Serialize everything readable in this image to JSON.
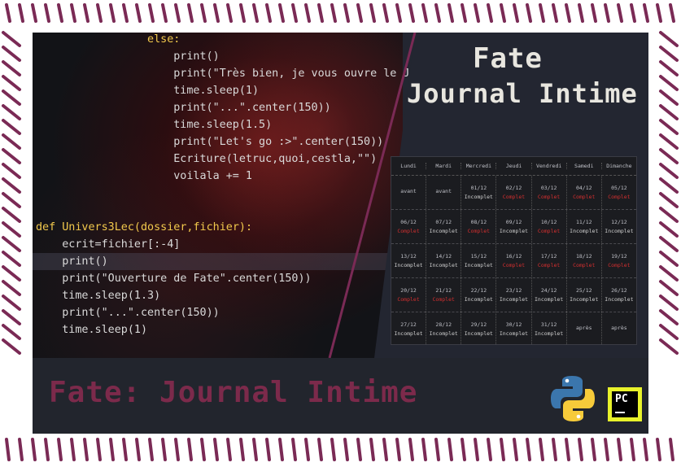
{
  "code": {
    "lines": [
      {
        "indent": 17,
        "text": "else:"
      },
      {
        "indent": 21,
        "text": "print()"
      },
      {
        "indent": 21,
        "text": "print(\"Très bien, je vous ouvre le J"
      },
      {
        "indent": 21,
        "text": "time.sleep(1)"
      },
      {
        "indent": 21,
        "text": "print(\"...\".center(150))"
      },
      {
        "indent": 21,
        "text": "time.sleep(1.5)"
      },
      {
        "indent": 21,
        "text": "print(\"Let's go :>\".center(150))"
      },
      {
        "indent": 21,
        "text": "Ecriture(letruc,quoi,cestla,\"\")"
      },
      {
        "indent": 21,
        "text": "voilala += 1"
      },
      {
        "indent": 0,
        "text": ""
      },
      {
        "indent": 0,
        "text": ""
      },
      {
        "indent": 0,
        "text": "def Univers3Lec(dossier,fichier):"
      },
      {
        "indent": 4,
        "text": "ecrit=fichier[:-4]"
      },
      {
        "indent": 4,
        "text": "print()"
      },
      {
        "indent": 4,
        "text": "print(\"Ouverture de Fate\".center(150))"
      },
      {
        "indent": 4,
        "text": "time.sleep(1.3)"
      },
      {
        "indent": 4,
        "text": "print(\"...\".center(150))"
      },
      {
        "indent": 4,
        "text": "time.sleep(1)"
      }
    ],
    "current_line": 13
  },
  "header": {
    "title_line1": "Fate",
    "title_line2": "Journal Intime"
  },
  "calendar": {
    "days": [
      "Lundi",
      "Mardi",
      "Mercredi",
      "Jeudi",
      "Vendredi",
      "Samedi",
      "Dimanche"
    ],
    "rows": [
      [
        [
          "avant",
          ""
        ],
        [
          "avant",
          ""
        ],
        [
          "01/12",
          "Incomplet"
        ],
        [
          "02/12",
          "Complet"
        ],
        [
          "03/12",
          "Complet"
        ],
        [
          "04/12",
          "Complet"
        ],
        [
          "05/12",
          "Complet"
        ]
      ],
      [
        [
          "06/12",
          "Complet"
        ],
        [
          "07/12",
          "Incomplet"
        ],
        [
          "08/12",
          "Complet"
        ],
        [
          "09/12",
          "Incomplet"
        ],
        [
          "10/12",
          "Complet"
        ],
        [
          "11/12",
          "Incomplet"
        ],
        [
          "12/12",
          "Incomplet"
        ]
      ],
      [
        [
          "13/12",
          "Incomplet"
        ],
        [
          "14/12",
          "Incomplet"
        ],
        [
          "15/12",
          "Incomplet"
        ],
        [
          "16/12",
          "Complet"
        ],
        [
          "17/12",
          "Complet"
        ],
        [
          "18/12",
          "Complet"
        ],
        [
          "19/12",
          "Complet"
        ]
      ],
      [
        [
          "20/12",
          "Complet"
        ],
        [
          "21/12",
          "Complet"
        ],
        [
          "22/12",
          "Incomplet"
        ],
        [
          "23/12",
          "Incomplet"
        ],
        [
          "24/12",
          "Incomplet"
        ],
        [
          "25/12",
          "Incomplet"
        ],
        [
          "26/12",
          "Incomplet"
        ]
      ],
      [
        [
          "27/12",
          "Incomplet"
        ],
        [
          "28/12",
          "Incomplet"
        ],
        [
          "29/12",
          "Incomplet"
        ],
        [
          "30/12",
          "Incomplet"
        ],
        [
          "31/12",
          "Incomplet"
        ],
        [
          "après",
          ""
        ],
        [
          "après",
          ""
        ]
      ]
    ],
    "status_colors": {
      "Complet": "#d32f2f",
      "Incomplet": "#cfcfcf"
    }
  },
  "bottom": {
    "title": "Fate: Journal Intime"
  },
  "icons": {
    "python": "python-logo-icon",
    "pycharm": "pycharm-logo-icon"
  },
  "colors": {
    "border_accent": "#7a2a55",
    "brand_title": "#7c2a4b",
    "keyword": "#f2c94c",
    "string": "#8fbf6a",
    "number": "#7db3ff"
  }
}
